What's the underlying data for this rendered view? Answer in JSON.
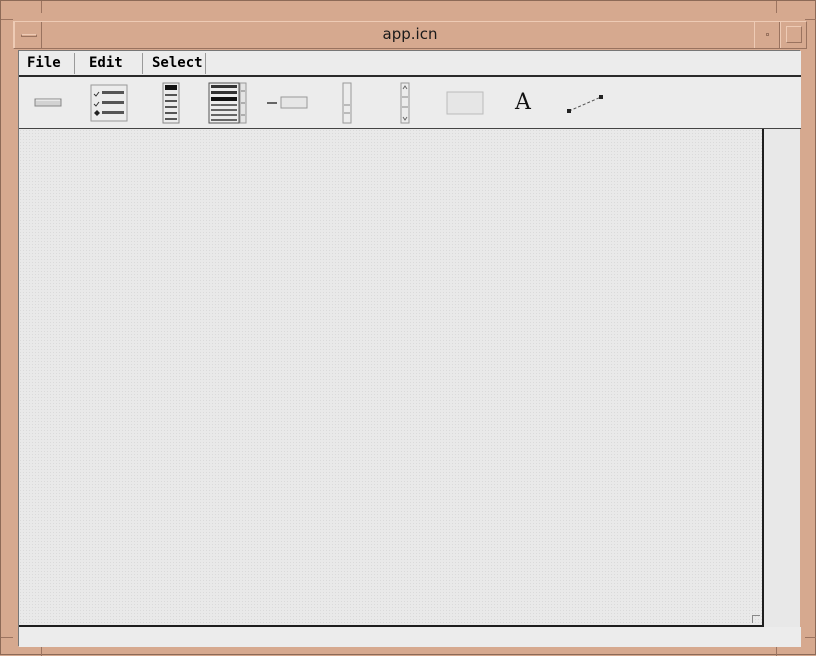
{
  "window": {
    "title": "app.icn"
  },
  "menubar": {
    "items": [
      {
        "label": "File"
      },
      {
        "label": "Edit"
      },
      {
        "label": "Select"
      }
    ]
  },
  "toolbar": {
    "tools": [
      {
        "icon": "button-tool-icon"
      },
      {
        "icon": "checkbox-list-tool-icon"
      },
      {
        "icon": "text-list-tool-icon"
      },
      {
        "icon": "scrolling-list-tool-icon"
      },
      {
        "icon": "text-field-tool-icon"
      },
      {
        "icon": "vertical-slider-tool-icon"
      },
      {
        "icon": "vertical-scrollbar-tool-icon"
      },
      {
        "icon": "region-tool-icon"
      },
      {
        "icon": "label-tool-icon",
        "glyph": "A"
      },
      {
        "icon": "line-tool-icon"
      }
    ]
  },
  "colors": {
    "frame": "#d6a98f",
    "client": "#e8e8e8",
    "canvas": "#e9e9e9"
  }
}
